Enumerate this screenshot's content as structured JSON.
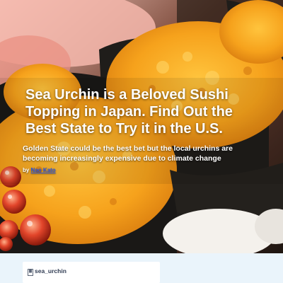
{
  "article": {
    "headline": "Sea Urchin is a Beloved Sushi Topping in Japan. Find Out the Best State to Try it in the U.S.",
    "subheadline": "Golden State could be the best bet but the local urchins are becoming increasingly expensive due to climate change",
    "byline_prefix": "by",
    "author": "Nao Kato"
  },
  "embed": {
    "handle": "sea_urchin",
    "icon": "bookmark-icon"
  },
  "colors": {
    "urchin": "#f5a623",
    "nori": "#1f1d1a",
    "roe": "#d9381e",
    "link": "#2a55e6",
    "page_background": "#eaf4fb"
  }
}
